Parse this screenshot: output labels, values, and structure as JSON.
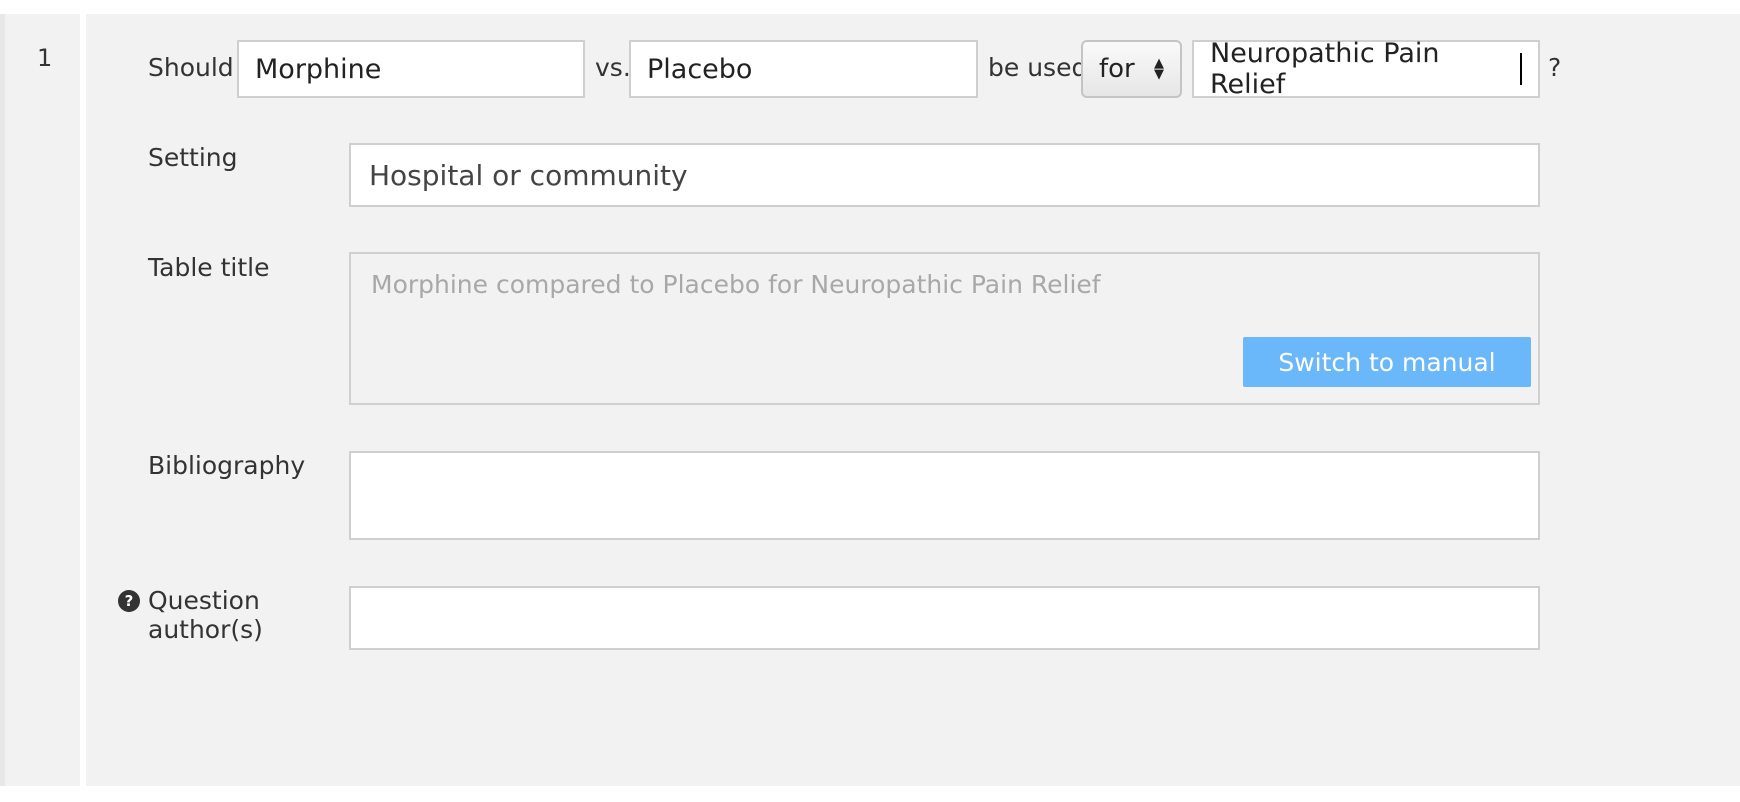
{
  "question": {
    "number": "1",
    "should_label": "Should",
    "intervention_value": "Morphine",
    "vs_label": "vs.",
    "comparison_value": "Placebo",
    "be_used_label": "be used",
    "preposition_select": "for",
    "condition_value": "Neuropathic Pain Relief",
    "question_mark": "?"
  },
  "setting": {
    "label": "Setting",
    "value": "Hospital or community"
  },
  "table_title": {
    "label": "Table title",
    "value": "Morphine compared to Placebo for Neuropathic Pain Relief",
    "switch_button": "Switch to manual"
  },
  "bibliography": {
    "label": "Bibliography",
    "value": ""
  },
  "authors": {
    "label_line1": "Question",
    "label_line2": "author(s)",
    "value": "",
    "help_icon_glyph": "?"
  },
  "colors": {
    "panel_bg": "#f2f2f2",
    "button_bg": "#6ab8f9",
    "input_border": "#cfcfcf"
  }
}
